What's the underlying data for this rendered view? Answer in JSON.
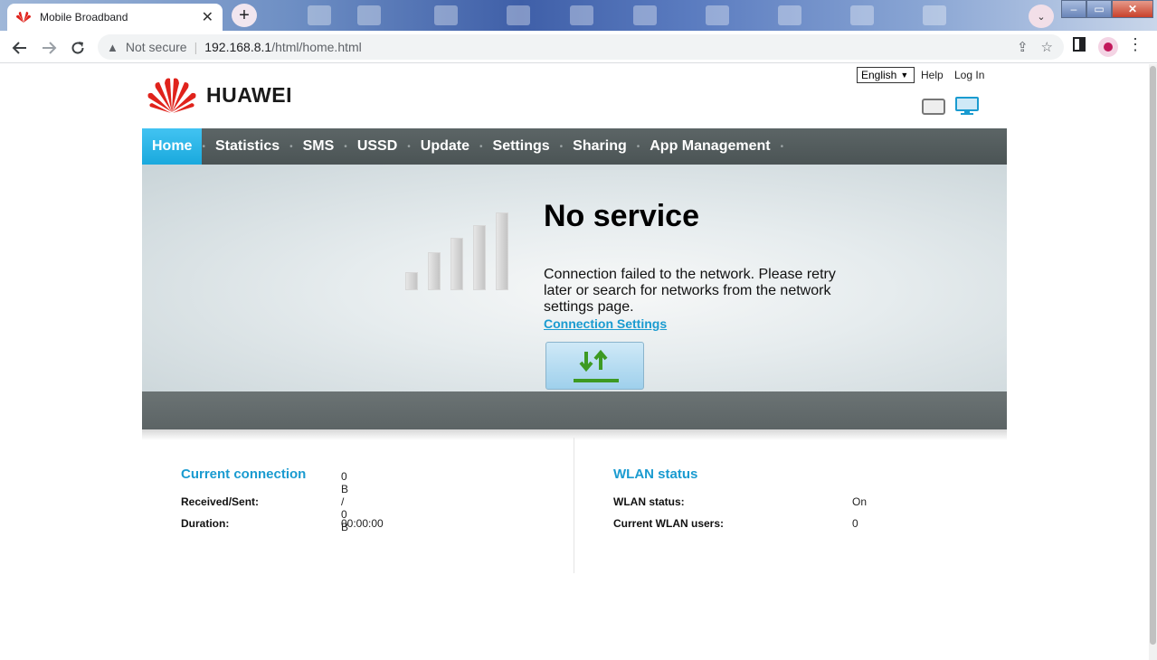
{
  "browser": {
    "tab_title": "Mobile Broadband",
    "tab_close": "✕",
    "new_tab": "+",
    "tab_search": "⌄",
    "window_controls": [
      "–",
      "▭",
      "✕"
    ],
    "security_label": "Not secure",
    "url_host": "192.168.8.1",
    "url_path": "/html/home.html"
  },
  "header": {
    "brand": "HUAWEI",
    "language": "English",
    "help_link": "Help",
    "login_link": "Log In"
  },
  "nav": {
    "items": [
      "Home",
      "Statistics",
      "SMS",
      "USSD",
      "Update",
      "Settings",
      "Sharing",
      "App Management"
    ],
    "active": "Home"
  },
  "status": {
    "title": "No service",
    "message": "Connection failed to the network. Please retry later or search for networks from the network settings page.",
    "link": "Connection Settings",
    "signal_bars": 0
  },
  "current_connection": {
    "heading": "Current connection",
    "received_sent_label": "Received/Sent:",
    "received_sent_value": "0 B /  0 B",
    "duration_label": "Duration:",
    "duration_value": "00:00:00"
  },
  "wlan": {
    "heading": "WLAN status",
    "status_label": "WLAN status:",
    "status_value": "On",
    "users_label": "Current WLAN users:",
    "users_value": "0"
  },
  "colors": {
    "accent": "#1a9bd0",
    "nav_bg": "#4b5455",
    "nav_active": "#1aa9dd",
    "brand_red": "#e0231c"
  }
}
